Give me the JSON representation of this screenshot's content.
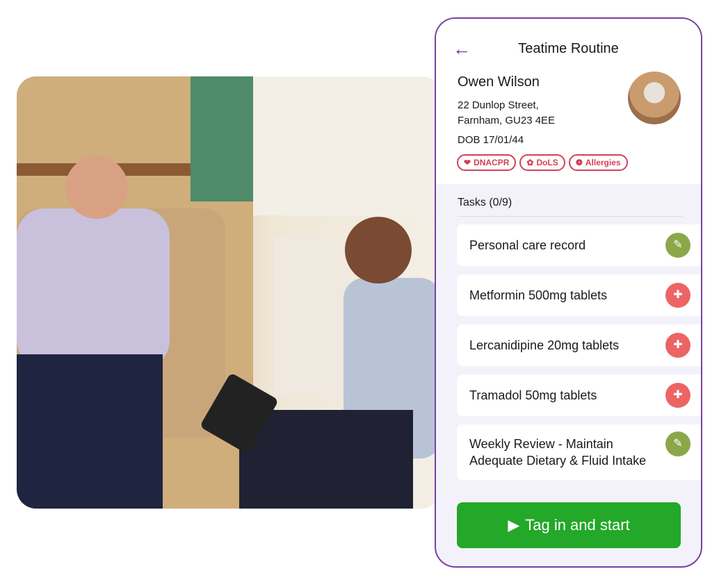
{
  "header": {
    "title": "Teatime Routine"
  },
  "patient": {
    "name": "Owen Wilson",
    "address_line1": "22 Dunlop Street,",
    "address_line2": "Farnham, GU23 4EE",
    "dob": "DOB 17/01/44",
    "badges": [
      {
        "label": "DNACPR",
        "icon": "heart-pulse-icon"
      },
      {
        "label": "DoLS",
        "icon": "hands-icon"
      },
      {
        "label": "Allergies",
        "icon": "allergy-icon"
      }
    ]
  },
  "tasks_heading": "Tasks (0/9)",
  "tasks": [
    {
      "label": "Personal care record",
      "icon": "checklist-icon",
      "color": "#8aa84a"
    },
    {
      "label": "Metformin 500mg tablets",
      "icon": "medical-kit-icon",
      "color": "#ec6464"
    },
    {
      "label": "Lercanidipine 20mg tablets",
      "icon": "medical-kit-icon",
      "color": "#ec6464"
    },
    {
      "label": "Tramadol 50mg tablets",
      "icon": "medical-kit-icon",
      "color": "#ec6464"
    },
    {
      "label": "Weekly Review - Maintain Adequate Dietary & Fluid Intake",
      "icon": "checklist-icon",
      "color": "#8aa84a"
    }
  ],
  "start_button": "Tag in and start",
  "colors": {
    "accent": "#7b3fa0",
    "badge": "#d1405a",
    "start": "#23a829"
  }
}
